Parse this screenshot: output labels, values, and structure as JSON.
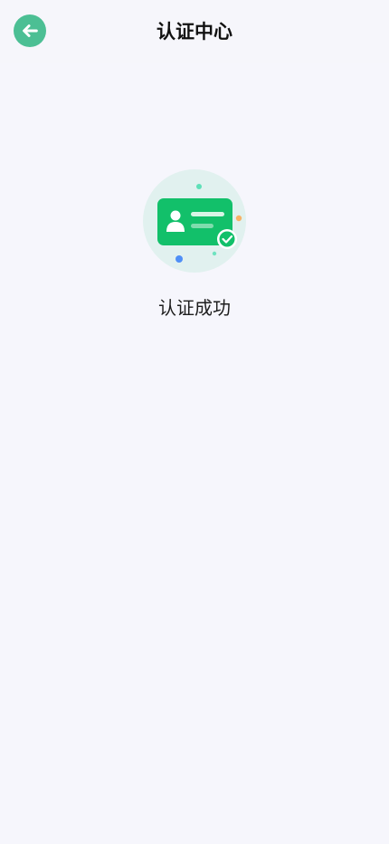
{
  "header": {
    "title": "认证中心",
    "back_icon": "arrow-left-icon"
  },
  "result": {
    "icon": "verified-id-card-icon",
    "text": "认证成功"
  },
  "colors": {
    "background": "#f6f6fc",
    "accent": "#4cbf94",
    "card_green": "#12c06a"
  }
}
